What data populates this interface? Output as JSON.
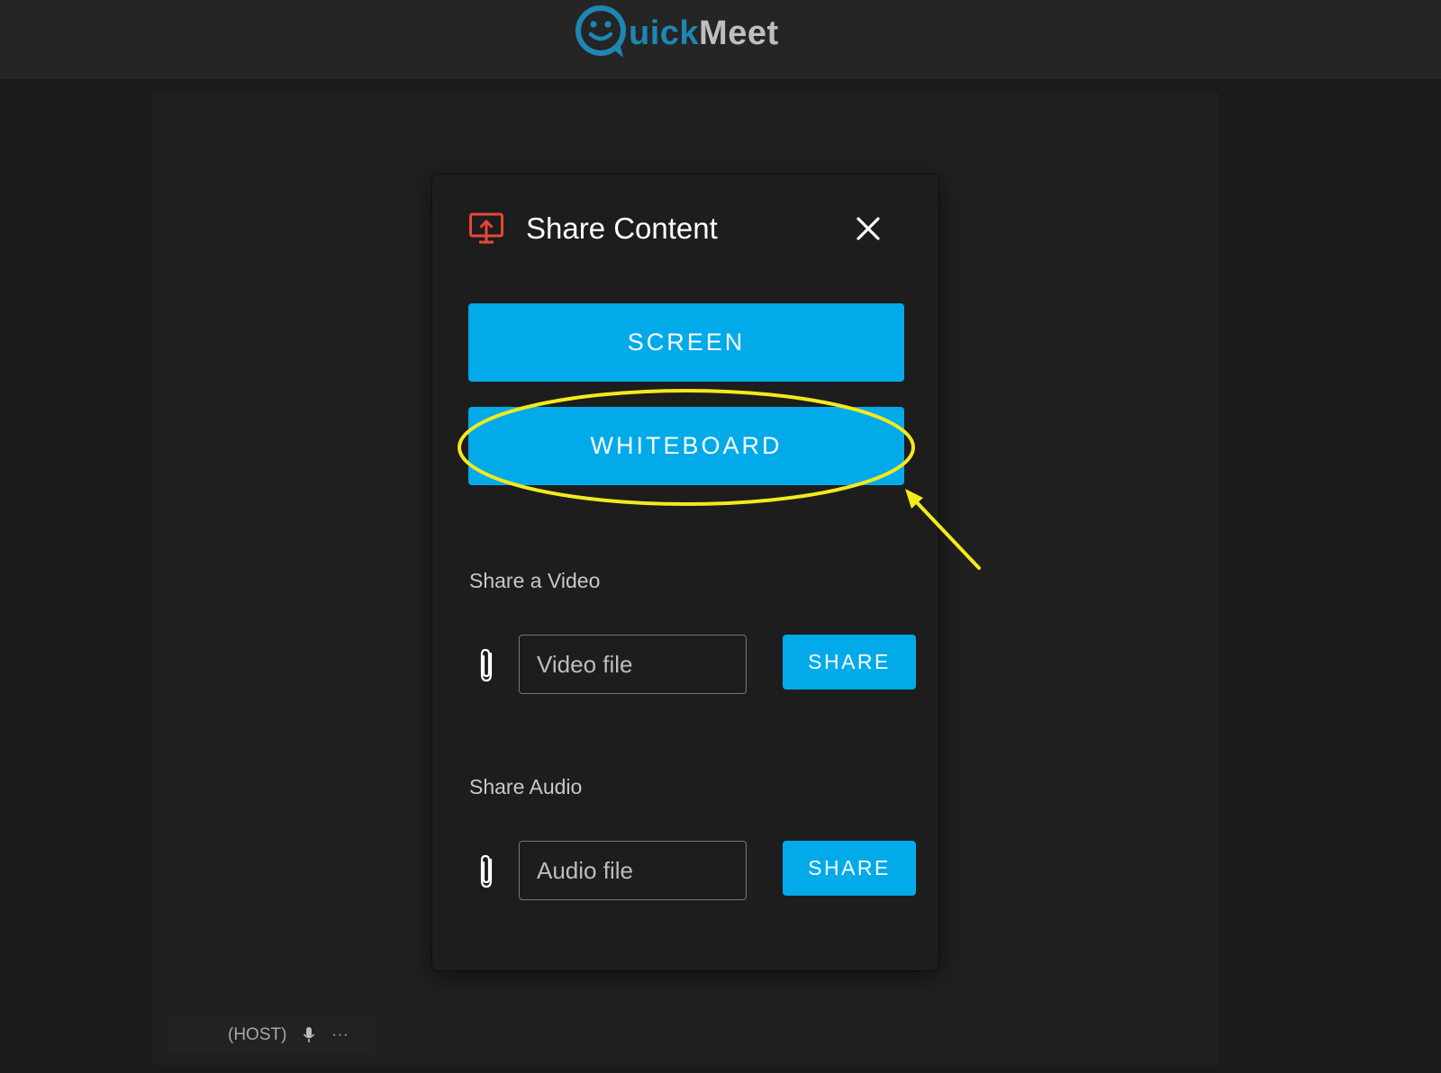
{
  "header": {
    "logo_text_part1": "uick",
    "logo_text_part2": "Meet",
    "logo_icon": "smiley-chat-bubble-icon"
  },
  "participant": {
    "role_label": "(HOST)",
    "mic_icon": "microphone-icon",
    "more_icon": "more-dots-icon",
    "more_label": "···"
  },
  "dialog": {
    "icon": "screen-share-icon",
    "title": "Share Content",
    "close_icon": "close-icon",
    "screen_button": "SCREEN",
    "whiteboard_button": "WHITEBOARD",
    "video": {
      "section_label": "Share a Video",
      "attach_icon": "paperclip-icon",
      "placeholder": "Video file",
      "share_button": "SHARE"
    },
    "audio": {
      "section_label": "Share Audio",
      "attach_icon": "paperclip-icon",
      "placeholder": "Audio file",
      "share_button": "SHARE"
    }
  },
  "annotation": {
    "shape": "ellipse-highlight",
    "target": "WHITEBOARD",
    "arrow": true
  },
  "colors": {
    "page_background": "#1b1b1b",
    "topbar": "#252525",
    "modal": "#1d1d1d",
    "accent_button": "#02aaea",
    "logo_blue": "#1e86b3",
    "share_icon_red": "#e8463a",
    "annotation_yellow": "#f3ea1c"
  }
}
